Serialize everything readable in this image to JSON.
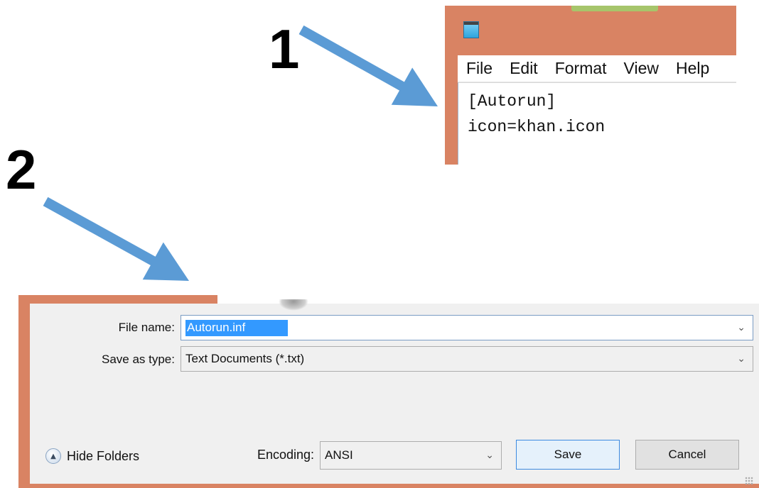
{
  "annotations": {
    "step1": "1",
    "step2": "2",
    "arrow_color": "#5b9bd5"
  },
  "notepad": {
    "frame_color": "#d98363",
    "menu": [
      "File",
      "Edit",
      "Format",
      "View",
      "Help"
    ],
    "content_lines": [
      "[Autorun]",
      "icon=khan.icon"
    ]
  },
  "save_dialog": {
    "file_name_label": "File name:",
    "file_name_value": "Autorun.inf",
    "save_as_type_label": "Save as type:",
    "save_as_type_value": "Text Documents (*.txt)",
    "hide_folders_label": "Hide Folders",
    "encoding_label": "Encoding:",
    "encoding_value": "ANSI",
    "save_label": "Save",
    "cancel_label": "Cancel"
  },
  "icons": {
    "notepad_app": "notepad-icon",
    "dropdown": "chevron-down-icon",
    "hide_folders": "chevron-up-circle-icon"
  }
}
